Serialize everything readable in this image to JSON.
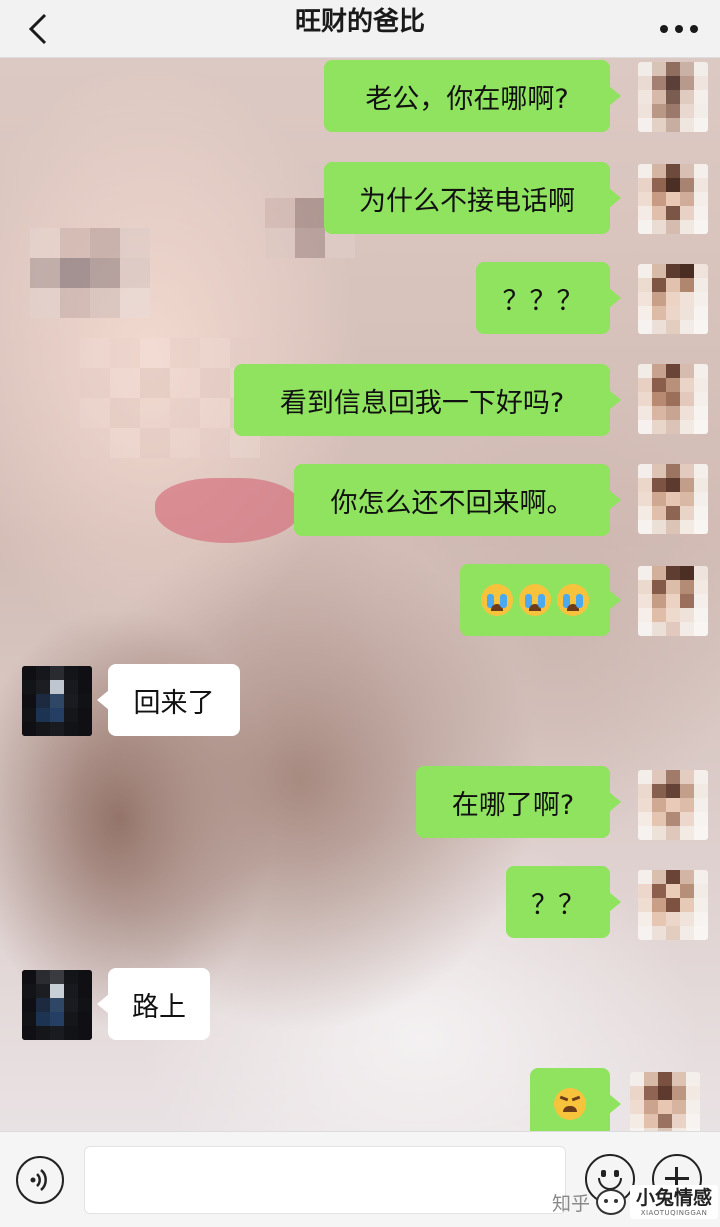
{
  "header": {
    "title": "旺财的爸比",
    "back_icon": "chevron-left-icon",
    "more_icon": "more-dots-icon"
  },
  "messages": [
    {
      "side": "right",
      "text": "老公，你在哪啊?"
    },
    {
      "side": "right",
      "text": "为什么不接电话啊"
    },
    {
      "side": "right",
      "text": "？？？"
    },
    {
      "side": "right",
      "text": "看到信息回我一下好吗?"
    },
    {
      "side": "right",
      "text": "你怎么还不回来啊。"
    },
    {
      "side": "right",
      "emoji": "crying-face-emoji x3"
    },
    {
      "side": "left",
      "text": "回来了"
    },
    {
      "side": "right",
      "text": "在哪了啊?"
    },
    {
      "side": "right",
      "text": "？？"
    },
    {
      "side": "left",
      "text": "路上"
    },
    {
      "side": "right",
      "emoji": "angry-face-emoji"
    }
  ],
  "input_bar": {
    "voice_icon": "voice-icon",
    "input_value": "",
    "emoji_icon": "emoji-icon",
    "plus_icon": "plus-icon"
  },
  "watermark": {
    "left_text": "知乎",
    "brand_name": "小兔情感",
    "brand_sub": "XIAOTUQINGGAN"
  },
  "colors": {
    "sent_bubble": "#8fe35e",
    "received_bubble": "#ffffff",
    "header_bg": "#f2f2f2"
  }
}
